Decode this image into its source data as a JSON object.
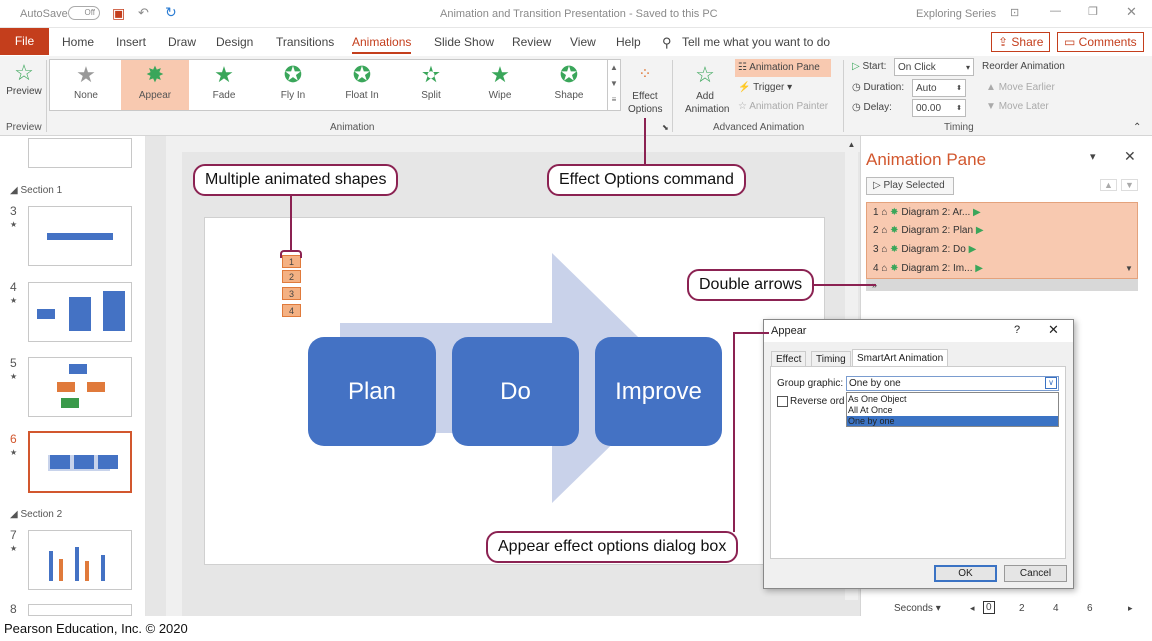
{
  "titlebar": {
    "autosave": "AutoSave",
    "toggle": "Off",
    "title": "Animation and Transition Presentation  -  Saved to this PC",
    "account": "Exploring Series"
  },
  "tabs": [
    "File",
    "Home",
    "Insert",
    "Draw",
    "Design",
    "Transitions",
    "Animations",
    "Slide Show",
    "Review",
    "View",
    "Help"
  ],
  "tell_me": "Tell me what you want to do",
  "share": "Share",
  "comments": "Comments",
  "ribbon": {
    "preview": "Preview",
    "preview_group": "Preview",
    "gallery": [
      "None",
      "Appear",
      "Fade",
      "Fly In",
      "Float In",
      "Split",
      "Wipe",
      "Shape"
    ],
    "effect_options": "Effect Options",
    "animation_group": "Animation",
    "add_animation": "Add Animation",
    "animation_pane": "Animation Pane",
    "trigger": "Trigger",
    "animation_painter": "Animation Painter",
    "advanced_group": "Advanced Animation",
    "start_label": "Start:",
    "start_value": "On Click",
    "duration_label": "Duration:",
    "duration_value": "Auto",
    "delay_label": "Delay:",
    "delay_value": "00.00",
    "reorder": "Reorder Animation",
    "move_earlier": "Move Earlier",
    "move_later": "Move Later",
    "timing_group": "Timing"
  },
  "slides_panel": {
    "section1": "Section 1",
    "section2": "Section 2",
    "numbers": [
      "3",
      "4",
      "5",
      "6",
      "7",
      "8"
    ],
    "selected": "6"
  },
  "slide": {
    "boxes": [
      "Plan",
      "Do",
      "Improve"
    ],
    "nums": [
      "1",
      "2",
      "3",
      "4"
    ]
  },
  "callouts": {
    "multiple": "Multiple animated shapes",
    "effect_cmd": "Effect Options command",
    "double_arrows": "Double arrows",
    "appear_dialog": "Appear effect options dialog box"
  },
  "pane": {
    "title": "Animation Pane",
    "play": "Play Selected",
    "items": [
      {
        "n": "1",
        "text": "Diagram 2: Ar..."
      },
      {
        "n": "2",
        "text": "Diagram 2: Plan"
      },
      {
        "n": "3",
        "text": "Diagram 2: Do"
      },
      {
        "n": "4",
        "text": "Diagram 2: Im..."
      }
    ],
    "seconds": "Seconds",
    "scale": [
      "0",
      "2",
      "4",
      "6"
    ]
  },
  "dialog": {
    "title": "Appear",
    "help": "?",
    "tabs": [
      "Effect",
      "Timing",
      "SmartArt Animation"
    ],
    "group_label": "Group graphic:",
    "group_value": "One by one",
    "options": [
      "As One Object",
      "All At Once",
      "One by one"
    ],
    "reverse": "Reverse orde",
    "ok": "OK",
    "cancel": "Cancel"
  },
  "credit": "Pearson Education, Inc. © 2020"
}
